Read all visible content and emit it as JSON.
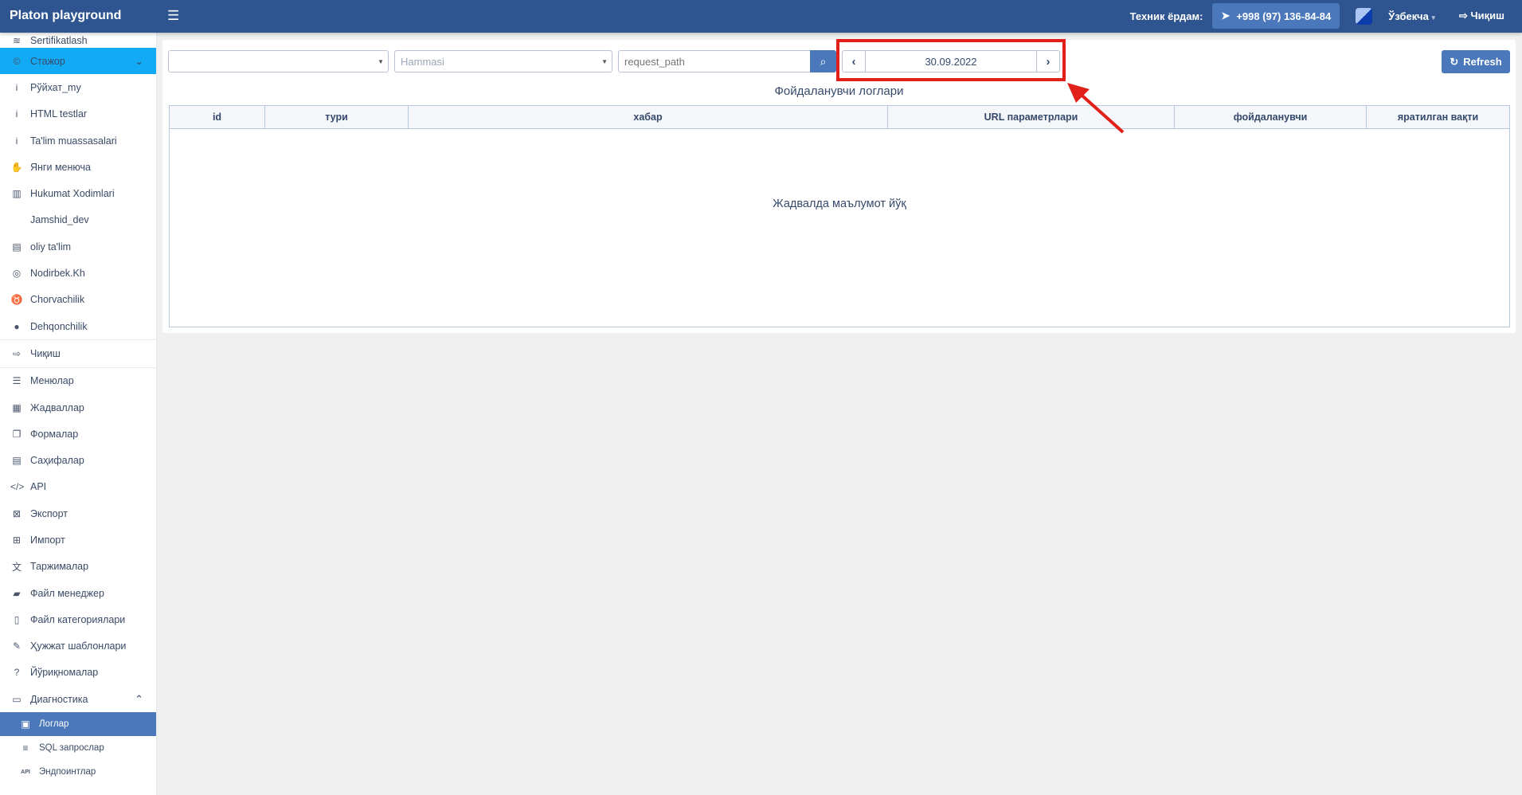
{
  "header": {
    "brand": "Platon playground",
    "tech_label": "Техник ёрдам:",
    "phone": "+998 (97) 136-84-84",
    "language": "Ўзбекча",
    "logout": "Чиқиш"
  },
  "sidebar": {
    "items": [
      {
        "label": "Sertifikatlash",
        "icon": "coins-icon"
      },
      {
        "label": "Стажор",
        "icon": "copyright-icon"
      },
      {
        "label": "Рўйхат_my",
        "icon": "info-icon"
      },
      {
        "label": "HTML testlar",
        "icon": "info-icon"
      },
      {
        "label": "Ta'lim muassasalari",
        "icon": "info-icon"
      },
      {
        "label": "Янги менюча",
        "icon": "hand-icon"
      },
      {
        "label": "Hukumat Xodimlari",
        "icon": "building-icon"
      },
      {
        "label": "Jamshid_dev",
        "icon": "none"
      },
      {
        "label": "oliy ta'lim",
        "icon": "file-icon"
      },
      {
        "label": "Nodirbek.Kh",
        "icon": "instagram-icon"
      },
      {
        "label": "Chorvachilik",
        "icon": "cow-icon"
      },
      {
        "label": "Dehqonchilik",
        "icon": "apple-icon"
      },
      {
        "label": "Чиқиш",
        "icon": "logout-icon"
      },
      {
        "label": "Менюлар",
        "icon": "list-icon"
      },
      {
        "label": "Жадваллар",
        "icon": "table-icon"
      },
      {
        "label": "Формалар",
        "icon": "forms-icon"
      },
      {
        "label": "Саҳифалар",
        "icon": "pages-icon"
      },
      {
        "label": "API",
        "icon": "code-icon"
      },
      {
        "label": "Экспорт",
        "icon": "export-icon"
      },
      {
        "label": "Импорт",
        "icon": "import-icon"
      },
      {
        "label": "Таржималар",
        "icon": "translate-icon"
      },
      {
        "label": "Файл менеджер",
        "icon": "folder-icon"
      },
      {
        "label": "Файл категориялари",
        "icon": "file-text-icon"
      },
      {
        "label": "Ҳужжат шаблонлари",
        "icon": "file-edit-icon"
      },
      {
        "label": "Йўриқномалар",
        "icon": "question-icon"
      },
      {
        "label": "Диагностика",
        "icon": "laptop-icon"
      },
      {
        "label": "Логлар",
        "icon": "log-icon"
      },
      {
        "label": "SQL запрослар",
        "icon": "database-icon"
      },
      {
        "label": "Эндпоинтлар",
        "icon": "api-icon",
        "icon_text": "API"
      }
    ]
  },
  "filters": {
    "select1": "",
    "select2": "Hammasi",
    "path_placeholder": "request_path",
    "date": "30.09.2022",
    "refresh": "Refresh"
  },
  "main": {
    "title": "Фойдаланувчи логлари",
    "columns": [
      "id",
      "тури",
      "хабар",
      "URL параметрлари",
      "фойдаланувчи",
      "яратилган вақти"
    ],
    "empty": "Жадвалда маълумот йўқ"
  },
  "annotation": {
    "color": "#e02019"
  }
}
